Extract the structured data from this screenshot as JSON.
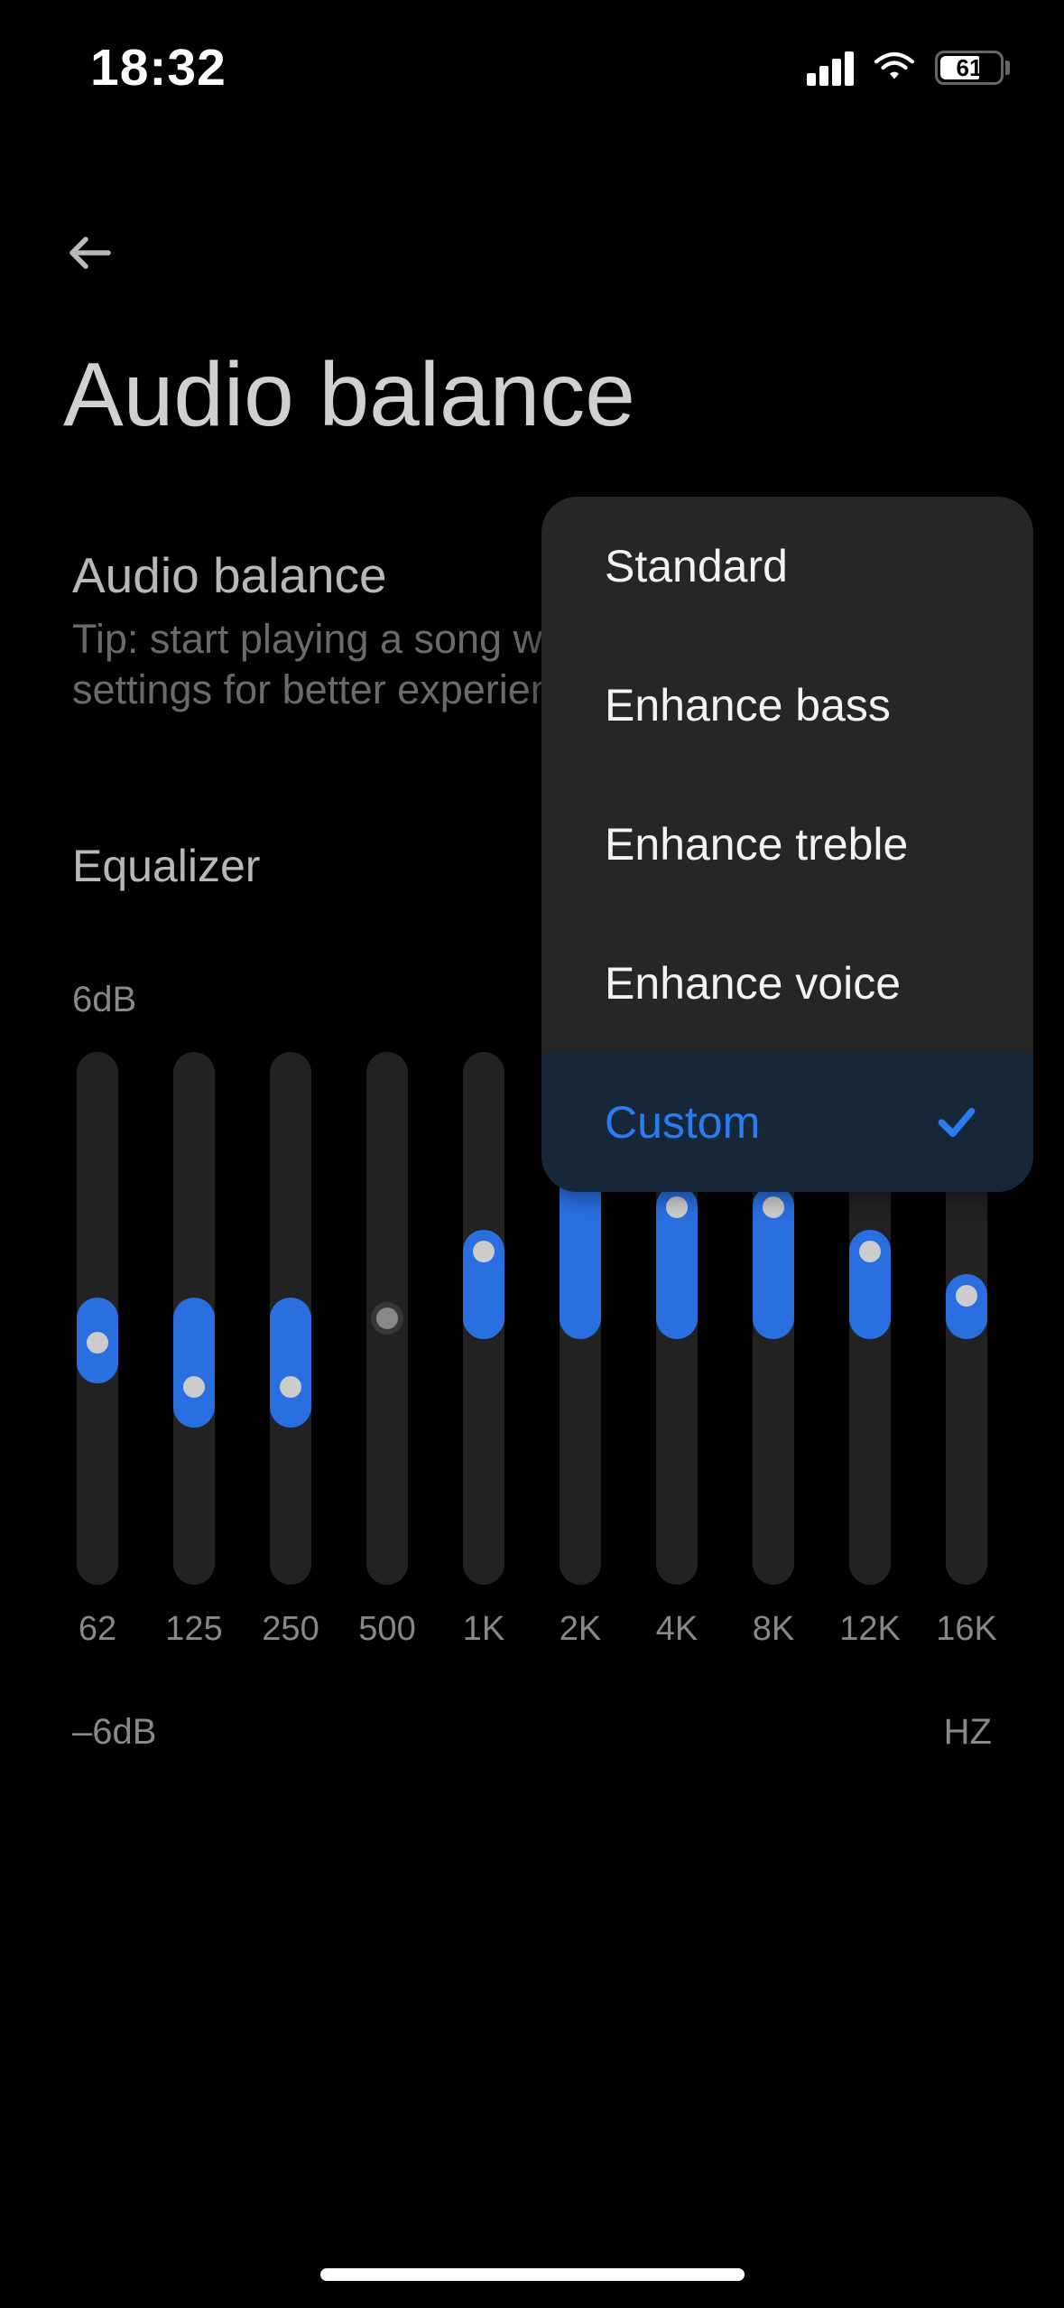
{
  "status": {
    "time": "18:32",
    "battery_percent": "61"
  },
  "page": {
    "title": "Audio balance",
    "section_title": "Audio balance",
    "tip": "Tip: start playing a song while choosing equalizer settings for better experience",
    "equalizer_label": "Equalizer"
  },
  "dropdown": {
    "options": [
      {
        "label": "Standard",
        "selected": false
      },
      {
        "label": "Enhance bass",
        "selected": false
      },
      {
        "label": "Enhance treble",
        "selected": false
      },
      {
        "label": "Enhance voice",
        "selected": false
      },
      {
        "label": "Custom",
        "selected": true
      }
    ]
  },
  "equalizer": {
    "max_label": "6dB",
    "min_label": "–6dB",
    "unit_label": "HZ",
    "max_db": 6,
    "min_db": -6,
    "bands": [
      {
        "freq": "62",
        "value": -1.0
      },
      {
        "freq": "125",
        "value": -2.0
      },
      {
        "freq": "250",
        "value": -2.0
      },
      {
        "freq": "500",
        "value": 0.0
      },
      {
        "freq": "1K",
        "value": 2.0
      },
      {
        "freq": "2K",
        "value": 4.0
      },
      {
        "freq": "4K",
        "value": 3.0
      },
      {
        "freq": "8K",
        "value": 3.0
      },
      {
        "freq": "12K",
        "value": 2.0
      },
      {
        "freq": "16K",
        "value": 1.0
      }
    ]
  },
  "colors": {
    "accent": "#2a6fe0",
    "accent_bright": "#2b7cf2",
    "bg": "#000",
    "panel": "#262626"
  }
}
